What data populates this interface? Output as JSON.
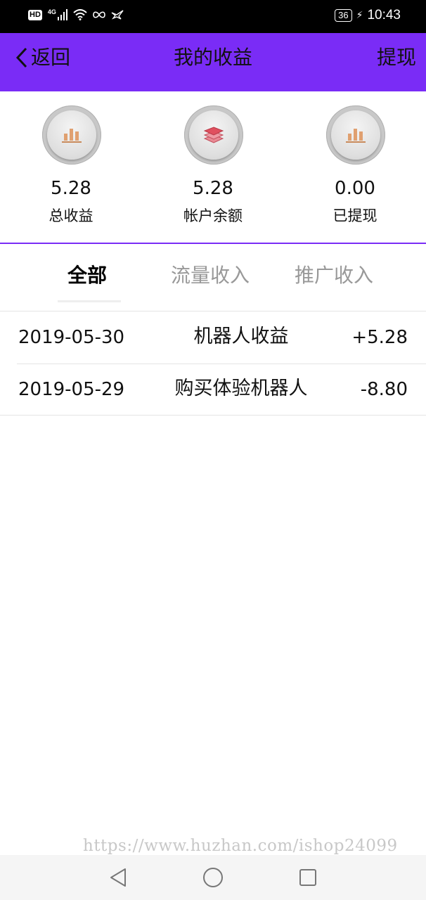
{
  "status_bar": {
    "hd": "HD",
    "network": "4G",
    "battery": "36",
    "time": "10:43"
  },
  "nav": {
    "back_label": "返回",
    "title": "我的收益",
    "action_label": "提现",
    "background_color": "#7a2cf6"
  },
  "stats": [
    {
      "icon": "bar-chart-icon",
      "value": "5.28",
      "label": "总收益"
    },
    {
      "icon": "layers-icon",
      "value": "5.28",
      "label": "帐户余额"
    },
    {
      "icon": "bar-chart-icon",
      "value": "0.00",
      "label": "已提现"
    }
  ],
  "tabs": [
    {
      "label": "全部",
      "active": true
    },
    {
      "label": "流量收入",
      "active": false
    },
    {
      "label": "推广收入",
      "active": false
    }
  ],
  "records": [
    {
      "date": "2019-05-30",
      "title": "机器人收益",
      "amount": "+5.28"
    },
    {
      "date": "2019-05-29",
      "title": "购买体验机器人",
      "amount": "-8.80"
    }
  ],
  "watermark": "https://www.huzhan.com/ishop24099",
  "system_nav": [
    "back-icon",
    "home-icon",
    "recents-icon"
  ]
}
